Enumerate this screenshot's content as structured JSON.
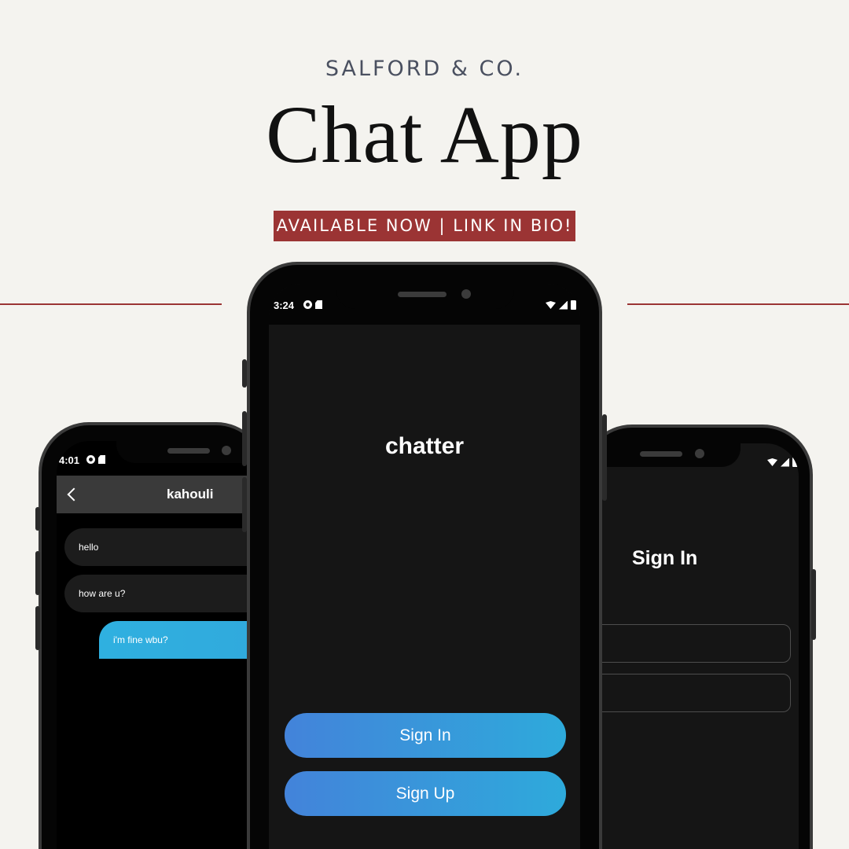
{
  "header": {
    "brand": "SALFORD & CO.",
    "title": "Chat App",
    "badge": "AVAILABLE NOW | LINK IN BIO!"
  },
  "colors": {
    "background": "#f4f3ef",
    "accent": "#9b3434",
    "button_gradient_start": "#4383da",
    "button_gradient_end": "#2eaadb"
  },
  "phone_left": {
    "status_time": "4:01",
    "chat_title": "kahouli",
    "messages": [
      {
        "text": "hello",
        "direction": "incoming"
      },
      {
        "text": "how are u?",
        "direction": "incoming"
      },
      {
        "text": "i'm fine wbu?",
        "direction": "outgoing"
      }
    ]
  },
  "phone_center": {
    "status_time": "3:24",
    "app_name": "chatter",
    "sign_in_label": "Sign In",
    "sign_up_label": "Sign Up"
  },
  "phone_right": {
    "screen_title": "Sign In"
  }
}
